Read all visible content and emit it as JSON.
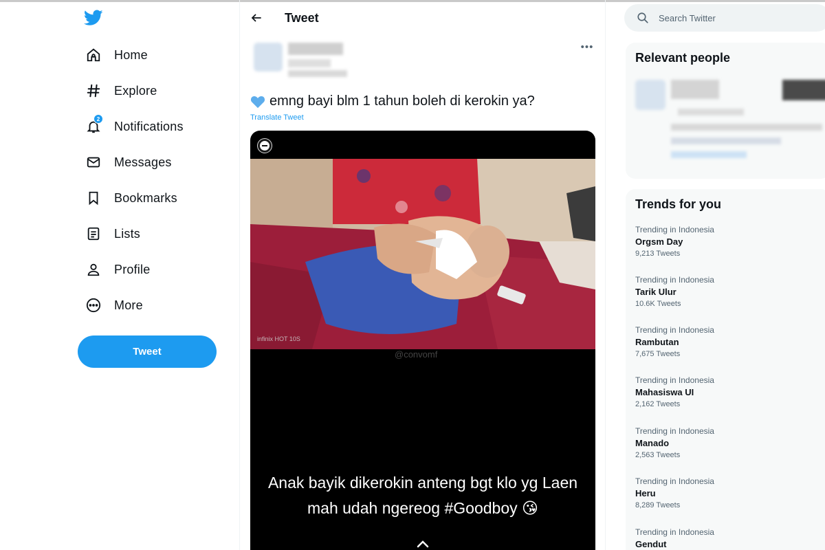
{
  "sidebar": {
    "logo": "twitter-bird-icon",
    "items": [
      {
        "label": "Home",
        "icon": "home-icon"
      },
      {
        "label": "Explore",
        "icon": "hashtag-icon"
      },
      {
        "label": "Notifications",
        "icon": "bell-icon",
        "badge": "2"
      },
      {
        "label": "Messages",
        "icon": "envelope-icon"
      },
      {
        "label": "Bookmarks",
        "icon": "bookmark-icon"
      },
      {
        "label": "Lists",
        "icon": "list-icon"
      },
      {
        "label": "Profile",
        "icon": "person-icon"
      },
      {
        "label": "More",
        "icon": "more-circle-icon"
      }
    ],
    "tweet_button": "Tweet"
  },
  "main": {
    "title": "Tweet",
    "tweet": {
      "text": "emng bayi blm 1 tahun boleh di kerokin ya?",
      "translate": "Translate Tweet",
      "media": {
        "device_watermark": "infinix HOT 10S",
        "handle_watermark": "@convomf",
        "caption_line1": "Anak bayik dikerokin anteng bgt klo yg Laen",
        "caption_line2": "mah udah ngereog #Goodboy 😘"
      }
    }
  },
  "right": {
    "search": {
      "placeholder": "Search Twitter"
    },
    "relevant_people_title": "Relevant people",
    "trends_title": "Trends for you",
    "trends": [
      {
        "context": "Trending in Indonesia",
        "name": "Orgsm Day",
        "count": "9,213 Tweets"
      },
      {
        "context": "Trending in Indonesia",
        "name": "Tarik Ulur",
        "count": "10.6K Tweets"
      },
      {
        "context": "Trending in Indonesia",
        "name": "Rambutan",
        "count": "7,675 Tweets"
      },
      {
        "context": "Trending in Indonesia",
        "name": "Mahasiswa UI",
        "count": "2,162 Tweets"
      },
      {
        "context": "Trending in Indonesia",
        "name": "Manado",
        "count": "2,563 Tweets"
      },
      {
        "context": "Trending in Indonesia",
        "name": "Heru",
        "count": "8,289 Tweets"
      },
      {
        "context": "Trending in Indonesia",
        "name": "Gendut",
        "count": ""
      }
    ]
  },
  "colors": {
    "accent": "#1d9bf0",
    "text": "#0f1419",
    "muted": "#536471",
    "card": "#f7f9f9"
  }
}
